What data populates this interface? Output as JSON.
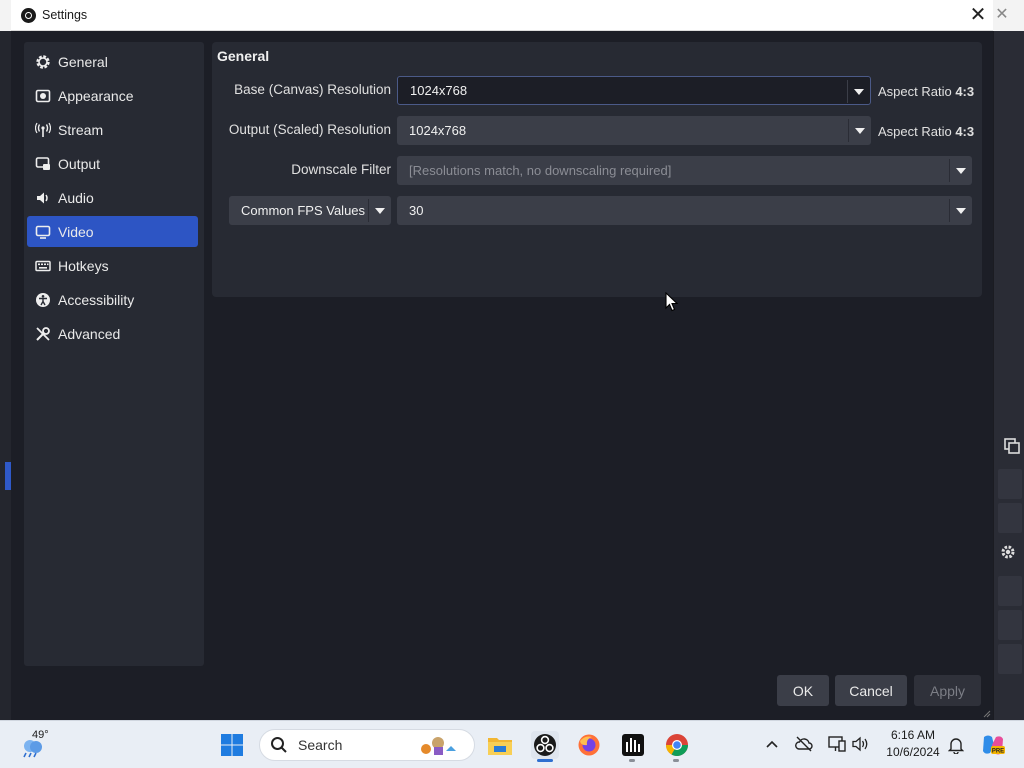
{
  "window": {
    "title": "Settings",
    "close_symbol": "✕"
  },
  "background": {
    "close_symbol": "✕"
  },
  "sidebar": {
    "items": [
      {
        "label": "General",
        "icon": "gear-icon"
      },
      {
        "label": "Appearance",
        "icon": "appearance-icon"
      },
      {
        "label": "Stream",
        "icon": "broadcast-icon"
      },
      {
        "label": "Output",
        "icon": "output-icon"
      },
      {
        "label": "Audio",
        "icon": "speaker-icon"
      },
      {
        "label": "Video",
        "icon": "monitor-icon",
        "active": true
      },
      {
        "label": "Hotkeys",
        "icon": "keyboard-icon"
      },
      {
        "label": "Accessibility",
        "icon": "accessibility-icon"
      },
      {
        "label": "Advanced",
        "icon": "tools-icon"
      }
    ]
  },
  "general": {
    "title": "General",
    "base_resolution": {
      "label": "Base (Canvas) Resolution",
      "value": "1024x768",
      "aspect_label": "Aspect Ratio",
      "aspect_value": "4:3"
    },
    "output_resolution": {
      "label": "Output (Scaled) Resolution",
      "value": "1024x768",
      "aspect_label": "Aspect Ratio",
      "aspect_value": "4:3"
    },
    "downscale_filter": {
      "label": "Downscale Filter",
      "value": "[Resolutions match, no downscaling required]"
    },
    "fps": {
      "type_value": "Common FPS Values",
      "value": "30"
    }
  },
  "buttons": {
    "ok": "OK",
    "cancel": "Cancel",
    "apply": "Apply"
  },
  "taskbar": {
    "temperature": "49°",
    "search_placeholder": "Search",
    "time": "6:16 AM",
    "date": "10/6/2024"
  },
  "colors": {
    "accent": "#2d55c4",
    "dialog_bg": "#1c1e26",
    "panel_bg": "#272a33",
    "control_bg": "#3b3e48"
  }
}
